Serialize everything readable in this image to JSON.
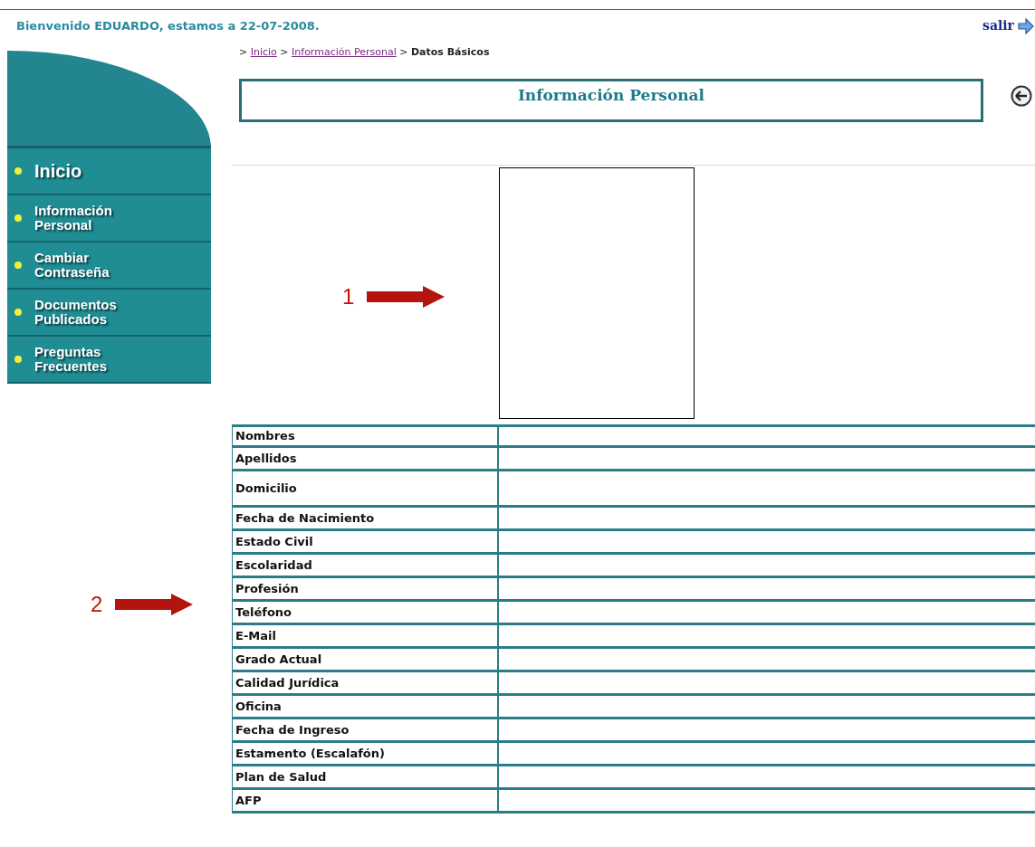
{
  "header": {
    "welcome": "Bienvenido EDUARDO, estamos a 22-07-2008.",
    "logout": "salir"
  },
  "sidebar": {
    "items": [
      {
        "label": "Inicio",
        "kind": "large"
      },
      {
        "label": "Información Personal",
        "kind": "normal"
      },
      {
        "label": "Cambiar Contraseña",
        "kind": "normal"
      },
      {
        "label": "Documentos Publicados",
        "kind": "normal"
      },
      {
        "label": "Preguntas Frecuentes",
        "kind": "normal"
      }
    ]
  },
  "breadcrumb": [
    {
      "separator": ">",
      "label": "Inicio",
      "kind": "link"
    },
    {
      "separator": ">",
      "label": "Información Personal",
      "kind": "link"
    },
    {
      "separator": ">",
      "label": "Datos Básicos",
      "kind": "current"
    }
  ],
  "title": "Información Personal",
  "fields": [
    {
      "label": "Nombres",
      "kind": "line"
    },
    {
      "label": "Apellidos",
      "kind": "line"
    },
    {
      "label": "Domicilio",
      "kind": "multiline"
    },
    {
      "label": "Fecha de Nacimiento",
      "kind": "line"
    },
    {
      "label": "Estado Civil",
      "kind": "line"
    },
    {
      "label": "Escolaridad",
      "kind": "line"
    },
    {
      "label": "Profesión",
      "kind": "line"
    },
    {
      "label": "Teléfono",
      "kind": "line"
    },
    {
      "label": "E-Mail",
      "kind": "line"
    },
    {
      "label": "Grado Actual",
      "kind": "line"
    },
    {
      "label": "Calidad Jurídica",
      "kind": "line"
    },
    {
      "label": "Oficina",
      "kind": "line"
    },
    {
      "label": "Fecha de Ingreso",
      "kind": "line"
    },
    {
      "label": "Estamento (Escalafón)",
      "kind": "line"
    },
    {
      "label": "Plan de Salud",
      "kind": "line"
    },
    {
      "label": "AFP",
      "kind": "line"
    }
  ],
  "annotations": [
    {
      "number": "1"
    },
    {
      "number": "2"
    }
  ]
}
